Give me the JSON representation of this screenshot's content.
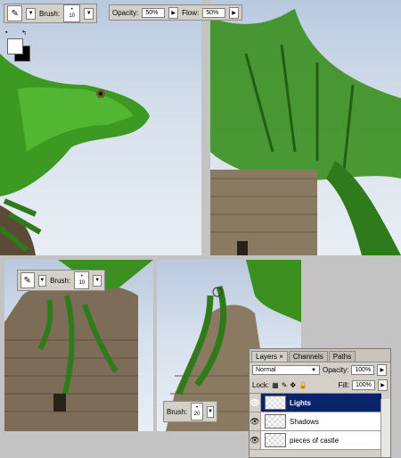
{
  "top_toolbar": {
    "brush_label": "Brush:",
    "brush_size": "10",
    "opacity_label": "Opacity:",
    "opacity_value": "50%",
    "flow_label": "Flow:",
    "flow_value": "50%"
  },
  "toolbar_mid": {
    "brush_label": "Brush:",
    "brush_size": "10"
  },
  "toolbar_bottom": {
    "brush_label": "Brush:",
    "brush_size": "20"
  },
  "layers_panel": {
    "tabs": [
      "Layers",
      "Channels",
      "Paths"
    ],
    "blend_mode": "Normal",
    "opacity_label": "Opacity:",
    "opacity_value": "100%",
    "lock_label": "Lock:",
    "fill_label": "Fill:",
    "fill_value": "100%",
    "layers": [
      {
        "name": "Lights",
        "selected": true
      },
      {
        "name": "Shadows",
        "selected": false
      },
      {
        "name": "pieces of castle",
        "selected": false
      }
    ]
  },
  "colors": {
    "selection": "#0a246a",
    "dragon_green": "#3f9f24",
    "panel_gray": "#d4d0c8"
  }
}
